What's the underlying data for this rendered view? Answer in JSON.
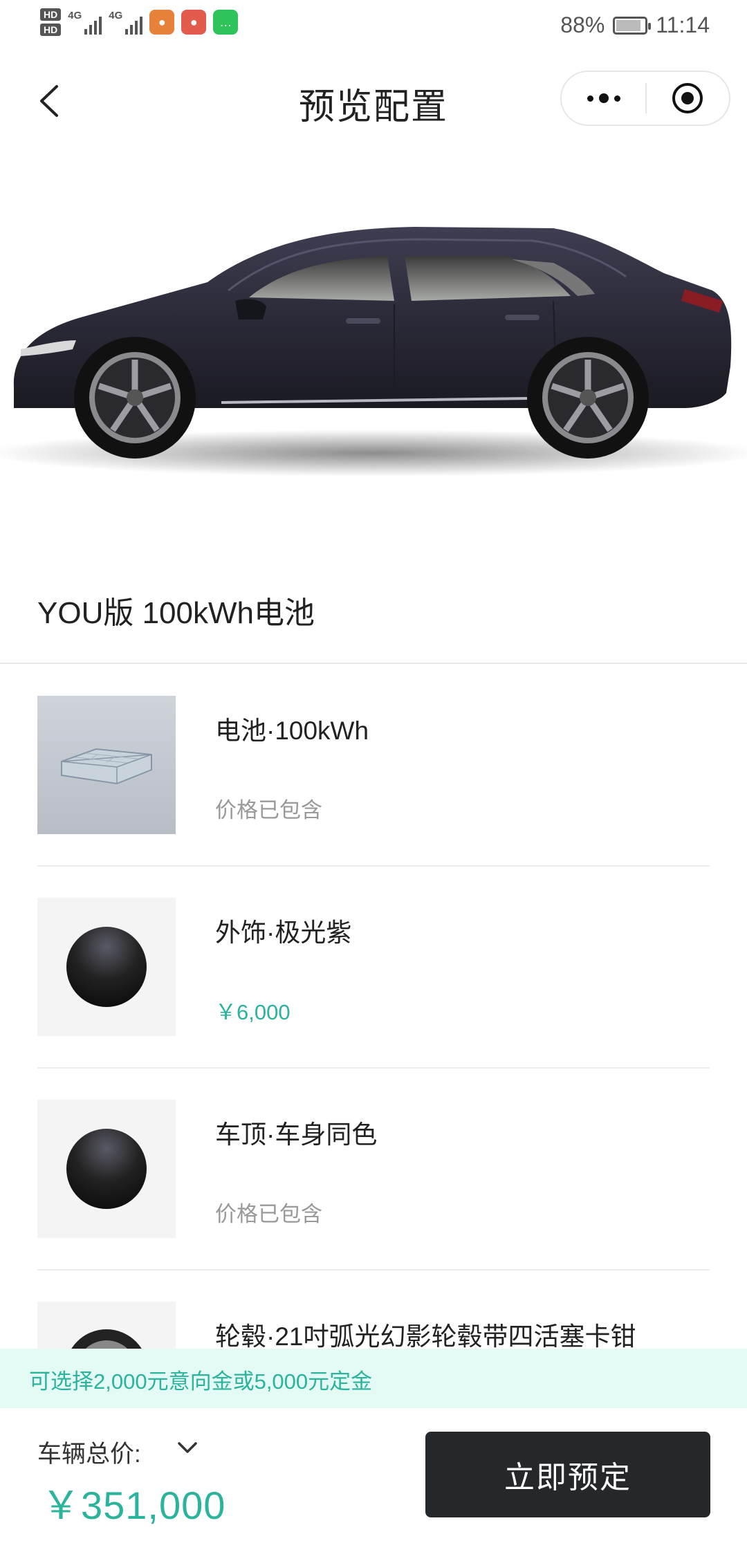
{
  "status_bar": {
    "hd1": "HD",
    "hd2": "HD",
    "net1": "4G",
    "net2": "4G",
    "battery_percent": "88%",
    "battery_level": 0.88,
    "time": "11:14"
  },
  "nav": {
    "title": "预览配置",
    "back_icon": "chevron-left-icon",
    "more_icon": "more-dots-icon",
    "target_icon": "target-icon"
  },
  "hero": {
    "image": "car-side-view",
    "car_color": "#2b2a38"
  },
  "config": {
    "title": "YOU版 100kWh电池"
  },
  "options": [
    {
      "name": "电池·100kWh",
      "price": "价格已包含",
      "thumb": "battery-pack-image",
      "paid": false
    },
    {
      "name": "外饰·极光紫",
      "price": "￥6,000",
      "thumb": "color-swatch",
      "paid": true
    },
    {
      "name": "车顶·车身同色",
      "price": "价格已包含",
      "thumb": "color-swatch",
      "paid": false
    },
    {
      "name": "轮毂·21吋弧光幻影轮毂带四活塞卡钳",
      "price": "",
      "thumb": "wheel-image",
      "paid": false
    }
  ],
  "deposit_banner": "可选择2,000元意向金或5,000元定金",
  "footer": {
    "total_label": "车辆总价:",
    "total_price": "￥351,000",
    "reserve_button": "立即预定"
  },
  "colors": {
    "accent": "#2bb39c",
    "banner_bg": "#e4faf5",
    "button_bg": "#24282b"
  }
}
